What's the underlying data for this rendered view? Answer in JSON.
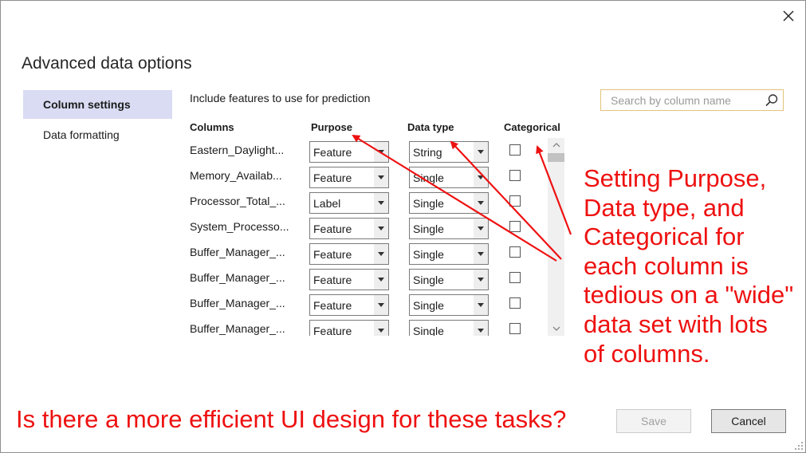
{
  "dialog": {
    "title": "Advanced data options",
    "close_icon": "close-icon"
  },
  "nav": {
    "items": [
      {
        "label": "Column settings",
        "active": true
      },
      {
        "label": "Data formatting",
        "active": false
      }
    ]
  },
  "main": {
    "subtitle": "Include features to use for prediction",
    "search": {
      "placeholder": "Search by column name",
      "value": "",
      "icon": "search-icon"
    },
    "headers": {
      "columns": "Columns",
      "purpose": "Purpose",
      "data_type": "Data type",
      "categorical": "Categorical"
    },
    "rows": [
      {
        "name": "Eastern_Daylight...",
        "purpose": "Feature",
        "data_type": "String",
        "categorical": false
      },
      {
        "name": "Memory_Availab...",
        "purpose": "Feature",
        "data_type": "Single",
        "categorical": false
      },
      {
        "name": "Processor_Total_...",
        "purpose": "Label",
        "data_type": "Single",
        "categorical": false
      },
      {
        "name": "System_Processo...",
        "purpose": "Feature",
        "data_type": "Single",
        "categorical": false
      },
      {
        "name": "Buffer_Manager_...",
        "purpose": "Feature",
        "data_type": "Single",
        "categorical": false
      },
      {
        "name": "Buffer_Manager_...",
        "purpose": "Feature",
        "data_type": "Single",
        "categorical": false
      },
      {
        "name": "Buffer_Manager_...",
        "purpose": "Feature",
        "data_type": "Single",
        "categorical": false
      },
      {
        "name": "Buffer_Manager_...",
        "purpose": "Feature",
        "data_type": "Single",
        "categorical": false
      }
    ]
  },
  "footer": {
    "save_label": "Save",
    "cancel_label": "Cancel"
  },
  "annotations": {
    "side_note": "Setting Purpose,\nData type, and\nCategorical for\neach column is\ntedious on a \"wide\"\ndata set with lots\nof columns.",
    "question": "Is there a more efficient UI design for these tasks?",
    "color": "#ee1111"
  },
  "colors": {
    "nav_active_bg": "#d9dcf3",
    "search_border": "#e2c47a",
    "annotation_red": "#ee1111"
  }
}
